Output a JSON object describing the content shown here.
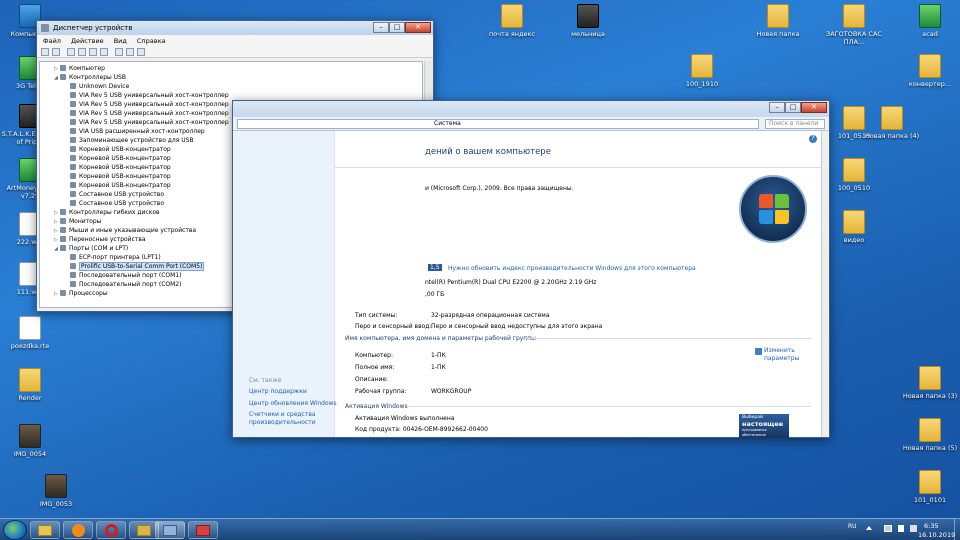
{
  "desktop_icons": [
    {
      "label": "Компьютер",
      "kind": "app"
    },
    {
      "label": "3G Tele2",
      "kind": "greenapp"
    },
    {
      "label": "S.T.A.L.K.E.R. Call of Prip...",
      "kind": "dark"
    },
    {
      "label": "ArtMoney PRO v7.29",
      "kind": "greenapp"
    },
    {
      "label": "222.wpt",
      "kind": "file"
    },
    {
      "label": "111.wpt",
      "kind": "file"
    },
    {
      "label": "poezdka.rte",
      "kind": "file"
    },
    {
      "label": "Render",
      "kind": "folder"
    },
    {
      "label": "IMG_0054",
      "kind": "photo"
    },
    {
      "label": "IMG_0053",
      "kind": "photo"
    },
    {
      "label": "почта яндекс",
      "kind": "folder"
    },
    {
      "label": "мельница",
      "kind": "dark"
    },
    {
      "label": "Новая папка",
      "kind": "folder"
    },
    {
      "label": "ЗАГОТОВКА САС ПЛА...",
      "kind": "folder"
    },
    {
      "label": "acad",
      "kind": "greenapp"
    },
    {
      "label": "100_1910",
      "kind": "folder"
    },
    {
      "label": "конвертер...",
      "kind": "folder"
    },
    {
      "label": "101_0510",
      "kind": "folder"
    },
    {
      "label": "Новая папка (4)",
      "kind": "folder"
    },
    {
      "label": "100_0510",
      "kind": "folder"
    },
    {
      "label": "видео",
      "kind": "folder"
    },
    {
      "label": "Новая папка (3)",
      "kind": "folder"
    },
    {
      "label": "Новая папка (5)",
      "kind": "folder"
    },
    {
      "label": "101_0101",
      "kind": "folder"
    }
  ],
  "device_manager": {
    "title": "Диспетчер устройств",
    "menu": [
      "Файл",
      "Действие",
      "Вид",
      "Справка"
    ],
    "tree": [
      {
        "label": "Компьютер",
        "level": 0,
        "exp": "▷"
      },
      {
        "label": "Контроллеры USB",
        "level": 0,
        "exp": "◢"
      },
      {
        "label": "Unknown Device",
        "level": 1,
        "exp": ""
      },
      {
        "label": "VIA Rev 5 USB универсальный хост-контроллер",
        "level": 1,
        "exp": ""
      },
      {
        "label": "VIA Rev 5 USB универсальный хост-контроллер",
        "level": 1,
        "exp": ""
      },
      {
        "label": "VIA Rev 5 USB универсальный хост-контроллер",
        "level": 1,
        "exp": ""
      },
      {
        "label": "VIA Rev 5 USB универсальный хост-контроллер",
        "level": 1,
        "exp": ""
      },
      {
        "label": "VIA USB расширенный хост-контроллер",
        "level": 1,
        "exp": ""
      },
      {
        "label": "Запоминающее устройство для USB",
        "level": 1,
        "exp": ""
      },
      {
        "label": "Корневой USB-концентратор",
        "level": 1,
        "exp": ""
      },
      {
        "label": "Корневой USB-концентратор",
        "level": 1,
        "exp": ""
      },
      {
        "label": "Корневой USB-концентратор",
        "level": 1,
        "exp": ""
      },
      {
        "label": "Корневой USB-концентратор",
        "level": 1,
        "exp": ""
      },
      {
        "label": "Корневой USB-концентратор",
        "level": 1,
        "exp": ""
      },
      {
        "label": "Составное USB устройство",
        "level": 1,
        "exp": ""
      },
      {
        "label": "Составное USB устройство",
        "level": 1,
        "exp": ""
      },
      {
        "label": "Контроллеры гибких дисков",
        "level": 0,
        "exp": "▷"
      },
      {
        "label": "Мониторы",
        "level": 0,
        "exp": "▷"
      },
      {
        "label": "Мыши и иные указывающие устройства",
        "level": 0,
        "exp": "▷"
      },
      {
        "label": "Переносные устройства",
        "level": 0,
        "exp": "▷"
      },
      {
        "label": "Порты (COM и LPT)",
        "level": 0,
        "exp": "◢"
      },
      {
        "label": "ECP-порт принтера (LPT1)",
        "level": 1,
        "exp": ""
      },
      {
        "label": "Prolific USB-to-Serial Comm Port (COM5)",
        "level": 1,
        "exp": "",
        "selected": true
      },
      {
        "label": "Последовательный порт (COM1)",
        "level": 1,
        "exp": ""
      },
      {
        "label": "Последовательный порт (COM2)",
        "level": 1,
        "exp": ""
      },
      {
        "label": "Процессоры",
        "level": 0,
        "exp": "▷"
      }
    ]
  },
  "system": {
    "address": "Система",
    "search_placeholder": "Поиск в панели",
    "heading": "дений о вашем компьютере",
    "copyright": "и (Microsoft Corp.), 2009. Все права защищены.",
    "index_link": "Нужно обновить индекс производительности Windows для этого компьютера",
    "score_badge": "1,5",
    "cpu": "ntel(R) Pentium(R) Dual  CPU  E2200  @ 2.20GHz   2.19 GHz",
    "ram": ",00 ГБ",
    "rows_system": [
      {
        "k": "Тип системы:",
        "v": "32-разрядная операционная система"
      },
      {
        "k": "Перо и сенсорный ввод:",
        "v": "Перо и сенсорный ввод недоступны для этого экрана"
      }
    ],
    "section_name": "Имя компьютера, имя домена и параметры рабочей группы",
    "rows_name": [
      {
        "k": "Компьютер:",
        "v": "1-ПК"
      },
      {
        "k": "Полное имя:",
        "v": "1-ПК"
      },
      {
        "k": "Описание:",
        "v": ""
      },
      {
        "k": "Рабочая группа:",
        "v": "WORKGROUP"
      }
    ],
    "change_link": "Изменить параметры",
    "section_activation": "Активация Windows",
    "activation_status": "Активация Windows выполнена",
    "product_key": "Код продукта: 00426-OEM-8992662-00400",
    "genuine_badge_1": "Выбирай",
    "genuine_badge_2": "настоящее",
    "genuine_badge_3": "программное обеспечение",
    "see_also": "См. также",
    "left_links": [
      "Центр поддержки",
      "Центр обновления Windows",
      "Счетчики и средства производительности"
    ]
  },
  "taskbar": {
    "lang": "RU",
    "time": "6:35",
    "date": "16.10.2019"
  }
}
